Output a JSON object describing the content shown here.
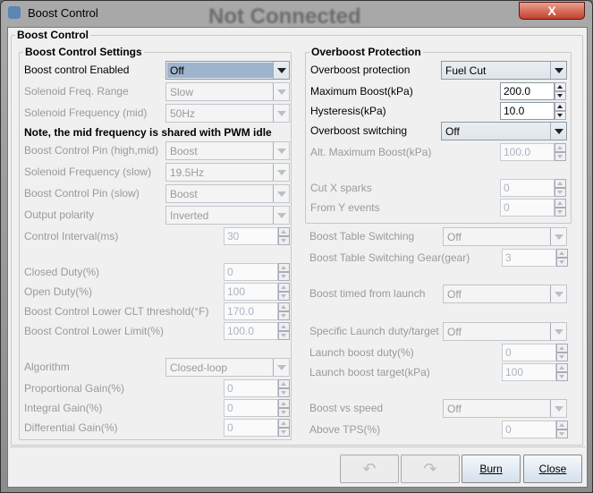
{
  "window": {
    "title": "Boost Control",
    "watermark": "Not Connected",
    "close_glyph": "X"
  },
  "outer_group": "Boost Control",
  "left": {
    "title": "Boost Control Settings",
    "rows": [
      {
        "label": "Boost control Enabled",
        "type": "combo",
        "value": "Off",
        "enabled": true,
        "selected": true
      },
      {
        "label": "Solenoid Freq. Range",
        "type": "combo",
        "value": "Slow",
        "enabled": false
      },
      {
        "label": "Solenoid Frequency (mid)",
        "type": "combo",
        "value": "50Hz",
        "enabled": false
      },
      {
        "label": "Note, the mid frequency is shared with PWM idle",
        "type": "note"
      },
      {
        "label": "Boost Control Pin (high,mid)",
        "type": "combo",
        "value": "Boost",
        "enabled": false
      },
      {
        "label": "Solenoid Frequency (slow)",
        "type": "combo",
        "value": "19.5Hz",
        "enabled": false
      },
      {
        "label": "Boost Control Pin (slow)",
        "type": "combo",
        "value": "Boost",
        "enabled": false
      },
      {
        "label": "Output polarity",
        "type": "combo",
        "value": "Inverted",
        "enabled": false
      },
      {
        "label": "Control Interval(ms)",
        "type": "spin",
        "value": "30",
        "enabled": false
      },
      {
        "label": "Closed Duty(%)",
        "type": "spin",
        "value": "0",
        "enabled": false
      },
      {
        "label": "Open Duty(%)",
        "type": "spin",
        "value": "100",
        "enabled": false
      },
      {
        "label": "Boost Control Lower CLT threshold(°F)",
        "type": "spin",
        "value": "170.0",
        "enabled": false
      },
      {
        "label": "Boost Control Lower Limit(%)",
        "type": "spin",
        "value": "100.0",
        "enabled": false
      },
      {
        "label": "Algorithm",
        "type": "combo",
        "value": "Closed-loop",
        "enabled": false
      },
      {
        "label": "Proportional Gain(%)",
        "type": "spin",
        "value": "0",
        "enabled": false
      },
      {
        "label": "Integral Gain(%)",
        "type": "spin",
        "value": "0",
        "enabled": false
      },
      {
        "label": "Differential Gain(%)",
        "type": "spin",
        "value": "0",
        "enabled": false
      }
    ]
  },
  "right": {
    "title": "Overboost Protection",
    "rows": [
      {
        "label": "Overboost protection",
        "type": "combo",
        "value": "Fuel Cut",
        "enabled": true
      },
      {
        "label": "Maximum Boost(kPa)",
        "type": "spin",
        "value": "200.0",
        "enabled": true
      },
      {
        "label": "Hysteresis(kPa)",
        "type": "spin",
        "value": "10.0",
        "enabled": true
      },
      {
        "label": "Overboost switching",
        "type": "combo",
        "value": "Off",
        "enabled": true
      },
      {
        "label": "Alt. Maximum Boost(kPa)",
        "type": "spin",
        "value": "100.0",
        "enabled": false
      },
      {
        "label": "Cut X sparks",
        "type": "spin",
        "value": "0",
        "enabled": false
      },
      {
        "label": "From Y events",
        "type": "spin",
        "value": "0",
        "enabled": false
      }
    ],
    "extra_rows": [
      {
        "label": "Boost Table Switching",
        "type": "combo",
        "value": "Off",
        "enabled": false
      },
      {
        "label": "Boost Table Switching Gear(gear)",
        "type": "spin",
        "value": "3",
        "enabled": false
      },
      {
        "label": "Boost timed from launch",
        "type": "combo",
        "value": "Off",
        "enabled": false
      },
      {
        "label": "Specific Launch duty/target",
        "type": "combo",
        "value": "Off",
        "enabled": false
      },
      {
        "label": "Launch boost duty(%)",
        "type": "spin",
        "value": "0",
        "enabled": false
      },
      {
        "label": "Launch boost target(kPa)",
        "type": "spin",
        "value": "100",
        "enabled": false
      },
      {
        "label": "Boost vs speed",
        "type": "combo",
        "value": "Off",
        "enabled": false
      },
      {
        "label": "Above TPS(%)",
        "type": "spin",
        "value": "0",
        "enabled": false
      }
    ]
  },
  "buttons": {
    "undo": "↶",
    "redo": "↷",
    "burn": "Burn",
    "close": "Close"
  }
}
